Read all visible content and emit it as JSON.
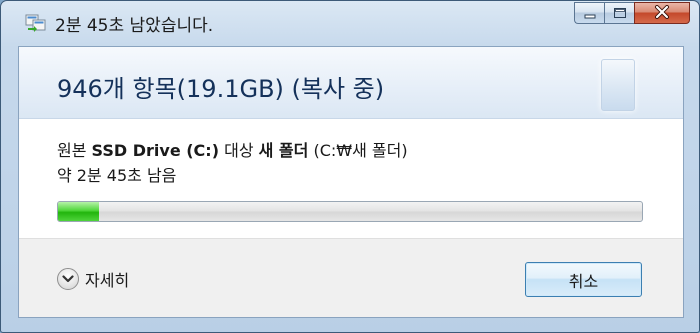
{
  "window": {
    "title": "2분 45초 남았습니다."
  },
  "caption_buttons": {
    "minimize_icon": "minimize-icon",
    "maximize_icon": "maximize-icon",
    "close_icon": "close-icon"
  },
  "header": {
    "title": "946개 항목(19.1GB) (복사 중)"
  },
  "transfer": {
    "source_prefix": "원본",
    "source_name": "SSD Drive (C:)",
    "dest_prefix": "대상",
    "dest_name": "새 폴더",
    "dest_path": "(C:₩새 폴더)",
    "time_remaining": "약 2분 45초 남음"
  },
  "progress": {
    "fraction": 0.07,
    "color": "#22b50d"
  },
  "footer": {
    "details_label": "자세히",
    "details_icon": "chevron-down-icon",
    "cancel_label": "취소"
  }
}
